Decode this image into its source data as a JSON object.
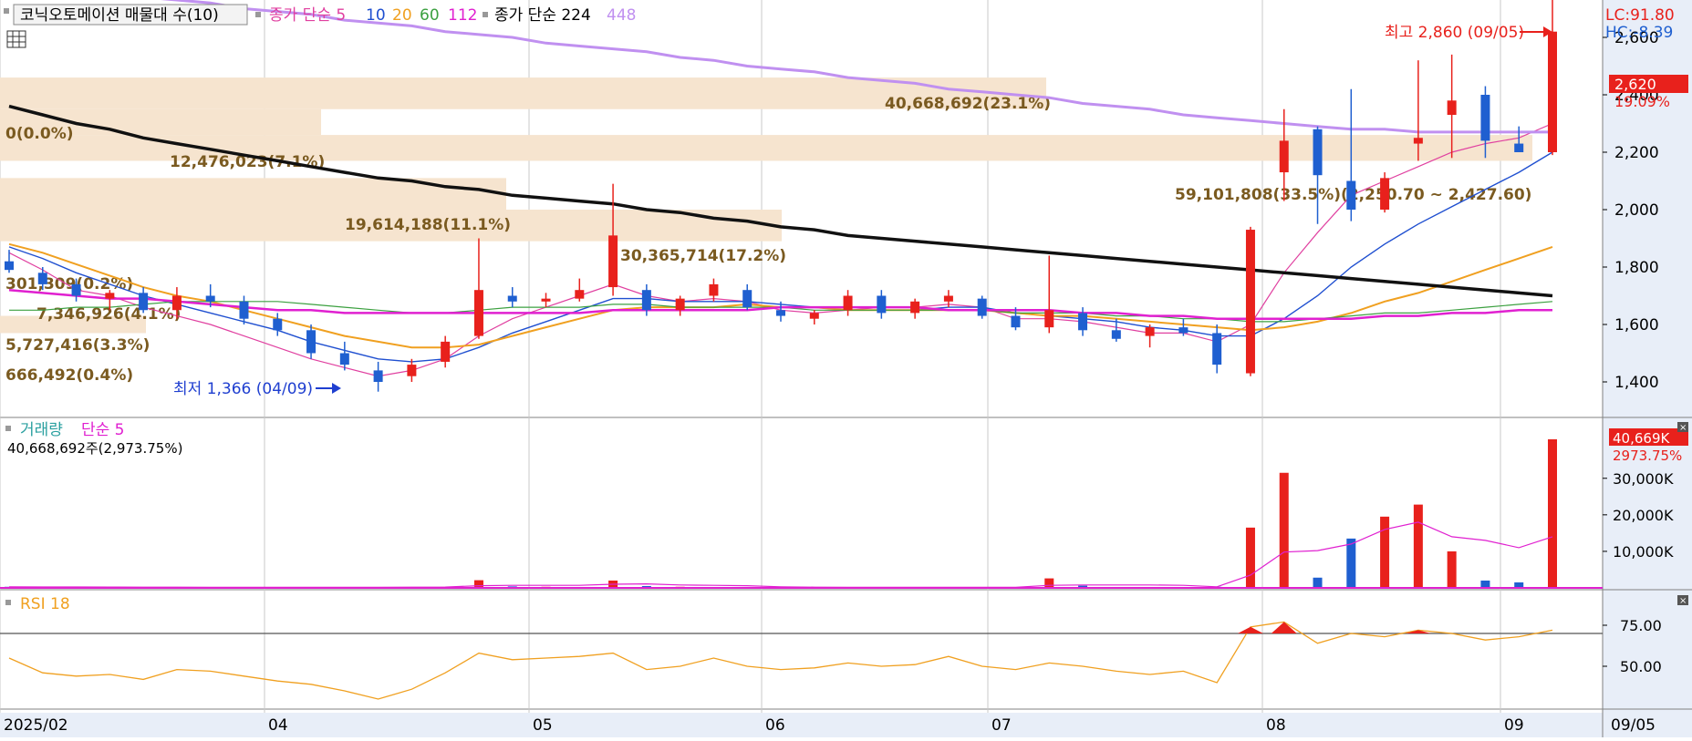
{
  "legend": {
    "stock_name": "코닉오토메이션 매물대 수(10)",
    "ma_label": "종가 단순 5",
    "ma_periods": [
      {
        "label": "10",
        "color": "#1f4fd0"
      },
      {
        "label": "20",
        "color": "#f0a020"
      },
      {
        "label": "60",
        "color": "#3ca040"
      },
      {
        "label": "112",
        "color": "#e020d0"
      }
    ],
    "ma5_color": "#e040a0",
    "long_label": "종가 단순 224",
    "long_period_extra": "448",
    "long_extra_color": "#c090f0"
  },
  "price_panel": {
    "lc": "LC:91.80",
    "hc": "HC:-8.39",
    "high_annotation": "최고 2,860 (09/05)",
    "low_annotation": "최저 1,366 (04/09)",
    "current_price": "2,620",
    "current_change": "19.09%",
    "y_ticks": [
      "2,600",
      "2,400",
      "2,200",
      "2,000",
      "1,800",
      "1,600",
      "1,400"
    ],
    "volume_profile": [
      {
        "label": "40,668,692(23.1%)",
        "low": 2350,
        "high": 2460
      },
      {
        "label": "0(0.0%)",
        "low": null,
        "high": null
      },
      {
        "label": "12,476,023(7.1%)",
        "low": 2260,
        "high": 2350
      },
      {
        "label": "59,101,808(33.5%)(2,250.70 ~ 2,427.60)",
        "low": 2170,
        "high": 2260
      },
      {
        "label": "19,614,188(11.1%)",
        "low": 2000,
        "high": 2110
      },
      {
        "label": "30,365,714(17.2%)",
        "low": 1890,
        "high": 2000
      },
      {
        "label": "301,309(0.2%)",
        "low": null,
        "high": null
      },
      {
        "label": "7,346,926(4.1%)",
        "low": null,
        "high": null
      },
      {
        "label": "5,727,416(3.3%)",
        "low": 1570,
        "high": 1630
      },
      {
        "label": "666,492(0.4%)",
        "low": null,
        "high": null
      }
    ]
  },
  "volume_panel": {
    "title": "거래량",
    "ma_label": "단순 5",
    "info": "40,668,692주(2,973.75%)",
    "current_value": "40,669K",
    "current_pct": "2973.75%",
    "y_ticks": [
      "30,000K",
      "20,000K",
      "10,000K"
    ]
  },
  "rsi_panel": {
    "title": "RSI 18",
    "y_ticks": [
      "75.00",
      "50.00"
    ]
  },
  "x_axis": {
    "labels": [
      "2025/02",
      "04",
      "05",
      "06",
      "07",
      "08",
      "09"
    ],
    "current_date": "09/05"
  },
  "colors": {
    "up": "#e8211c",
    "down": "#1f5fd0",
    "ma224": "#111111",
    "ma448": "#c090f0",
    "rsi": "#f0a020",
    "profile": "#f6e4cf",
    "profile_text": "#7a5a20"
  },
  "chart_data": {
    "type": "candlestick",
    "x_range": [
      "2025-02-03",
      "2025-09-05"
    ],
    "ylim": [
      1366,
      2860
    ],
    "candles": [
      {
        "date": "2025-02-03",
        "open": 1820,
        "high": 1860,
        "low": 1780,
        "close": 1790
      },
      {
        "date": "2025-02-10",
        "open": 1780,
        "high": 1800,
        "low": 1720,
        "close": 1740
      },
      {
        "date": "2025-02-17",
        "open": 1740,
        "high": 1760,
        "low": 1680,
        "close": 1700
      },
      {
        "date": "2025-02-24",
        "open": 1690,
        "high": 1720,
        "low": 1650,
        "close": 1710
      },
      {
        "date": "2025-03-03",
        "open": 1710,
        "high": 1730,
        "low": 1640,
        "close": 1650
      },
      {
        "date": "2025-03-10",
        "open": 1650,
        "high": 1730,
        "low": 1620,
        "close": 1700
      },
      {
        "date": "2025-03-17",
        "open": 1700,
        "high": 1740,
        "low": 1660,
        "close": 1680
      },
      {
        "date": "2025-03-24",
        "open": 1680,
        "high": 1700,
        "low": 1600,
        "close": 1620
      },
      {
        "date": "2025-03-31",
        "open": 1620,
        "high": 1640,
        "low": 1560,
        "close": 1580
      },
      {
        "date": "2025-04-04",
        "open": 1580,
        "high": 1600,
        "low": 1480,
        "close": 1500
      },
      {
        "date": "2025-04-07",
        "open": 1500,
        "high": 1540,
        "low": 1440,
        "close": 1460
      },
      {
        "date": "2025-04-09",
        "open": 1440,
        "high": 1470,
        "low": 1366,
        "close": 1400
      },
      {
        "date": "2025-04-14",
        "open": 1420,
        "high": 1480,
        "low": 1400,
        "close": 1460
      },
      {
        "date": "2025-04-21",
        "open": 1470,
        "high": 1560,
        "low": 1450,
        "close": 1540
      },
      {
        "date": "2025-04-25",
        "open": 1560,
        "high": 1900,
        "low": 1550,
        "close": 1720
      },
      {
        "date": "2025-04-30",
        "open": 1700,
        "high": 1730,
        "low": 1660,
        "close": 1680
      },
      {
        "date": "2025-05-07",
        "open": 1680,
        "high": 1710,
        "low": 1660,
        "close": 1690
      },
      {
        "date": "2025-05-14",
        "open": 1690,
        "high": 1760,
        "low": 1680,
        "close": 1720
      },
      {
        "date": "2025-05-21",
        "open": 1730,
        "high": 2090,
        "low": 1700,
        "close": 1910
      },
      {
        "date": "2025-05-23",
        "open": 1720,
        "high": 1740,
        "low": 1630,
        "close": 1650
      },
      {
        "date": "2025-05-28",
        "open": 1650,
        "high": 1700,
        "low": 1630,
        "close": 1690
      },
      {
        "date": "2025-06-04",
        "open": 1700,
        "high": 1760,
        "low": 1680,
        "close": 1740
      },
      {
        "date": "2025-06-11",
        "open": 1720,
        "high": 1740,
        "low": 1650,
        "close": 1660
      },
      {
        "date": "2025-06-18",
        "open": 1650,
        "high": 1680,
        "low": 1610,
        "close": 1630
      },
      {
        "date": "2025-06-25",
        "open": 1620,
        "high": 1650,
        "low": 1600,
        "close": 1640
      },
      {
        "date": "2025-07-02",
        "open": 1650,
        "high": 1720,
        "low": 1630,
        "close": 1700
      },
      {
        "date": "2025-07-09",
        "open": 1700,
        "high": 1720,
        "low": 1620,
        "close": 1640
      },
      {
        "date": "2025-07-16",
        "open": 1640,
        "high": 1690,
        "low": 1620,
        "close": 1680
      },
      {
        "date": "2025-07-23",
        "open": 1680,
        "high": 1720,
        "low": 1660,
        "close": 1700
      },
      {
        "date": "2025-07-30",
        "open": 1690,
        "high": 1700,
        "low": 1620,
        "close": 1630
      },
      {
        "date": "2025-08-06",
        "open": 1630,
        "high": 1660,
        "low": 1580,
        "close": 1590
      },
      {
        "date": "2025-08-13",
        "open": 1590,
        "high": 1840,
        "low": 1570,
        "close": 1650
      },
      {
        "date": "2025-08-20",
        "open": 1640,
        "high": 1660,
        "low": 1560,
        "close": 1580
      },
      {
        "date": "2025-08-27",
        "open": 1580,
        "high": 1620,
        "low": 1540,
        "close": 1550
      },
      {
        "date": "2025-09-03",
        "open": 1560,
        "high": 1600,
        "low": 1520,
        "close": 1590
      },
      {
        "date": "2025-09-10",
        "open": 1590,
        "high": 1620,
        "low": 1560,
        "close": 1570
      },
      {
        "date": "2025-09-17",
        "open": 1570,
        "high": 1600,
        "low": 1430,
        "close": 1460
      },
      {
        "date": "2025-09-22",
        "open": 1430,
        "high": 1940,
        "low": 1420,
        "close": 1930
      },
      {
        "date": "2025-09-23",
        "open": 2130,
        "high": 2350,
        "low": 2030,
        "close": 2240
      },
      {
        "date": "2025-09-24",
        "open": 2280,
        "high": 2290,
        "low": 1950,
        "close": 2120
      },
      {
        "date": "2025-09-25",
        "open": 2100,
        "high": 2420,
        "low": 1960,
        "close": 2000
      },
      {
        "date": "2025-09-26",
        "open": 2000,
        "high": 2130,
        "low": 1990,
        "close": 2110
      },
      {
        "date": "2025-09-29",
        "open": 2230,
        "high": 2520,
        "low": 2170,
        "close": 2250
      },
      {
        "date": "2025-09-30",
        "open": 2330,
        "high": 2540,
        "low": 2180,
        "close": 2380
      },
      {
        "date": "2025-10-01",
        "open": 2400,
        "high": 2430,
        "low": 2180,
        "close": 2240
      },
      {
        "date": "2025-10-02",
        "open": 2230,
        "high": 2290,
        "low": 2200,
        "close": 2200
      },
      {
        "date": "2025-10-03",
        "open": 2200,
        "high": 2860,
        "low": 2190,
        "close": 2620
      }
    ],
    "moving_averages": [
      {
        "name": "5",
        "values": [
          1850,
          1790,
          1720,
          1700,
          1660,
          1630,
          1600,
          1560,
          1520,
          1480,
          1450,
          1420,
          1440,
          1480,
          1560,
          1620,
          1660,
          1700,
          1740,
          1700,
          1680,
          1690,
          1680,
          1650,
          1640,
          1650,
          1660,
          1660,
          1670,
          1660,
          1620,
          1620,
          1610,
          1590,
          1570,
          1570,
          1540,
          1600,
          1780,
          1920,
          2050,
          2100,
          2150,
          2200,
          2230,
          2250,
          2300
        ]
      },
      {
        "name": "10",
        "values": [
          1870,
          1830,
          1780,
          1740,
          1700,
          1670,
          1640,
          1610,
          1580,
          1540,
          1510,
          1480,
          1470,
          1480,
          1520,
          1570,
          1610,
          1650,
          1690,
          1690,
          1680,
          1680,
          1680,
          1670,
          1660,
          1650,
          1650,
          1650,
          1660,
          1660,
          1640,
          1630,
          1620,
          1610,
          1590,
          1580,
          1560,
          1560,
          1620,
          1700,
          1800,
          1880,
          1950,
          2010,
          2070,
          2130,
          2200
        ]
      },
      {
        "name": "20",
        "values": [
          1880,
          1850,
          1810,
          1770,
          1730,
          1700,
          1680,
          1650,
          1620,
          1590,
          1560,
          1540,
          1520,
          1520,
          1530,
          1560,
          1590,
          1620,
          1650,
          1660,
          1660,
          1660,
          1670,
          1660,
          1660,
          1650,
          1650,
          1650,
          1650,
          1650,
          1640,
          1630,
          1630,
          1620,
          1610,
          1600,
          1590,
          1580,
          1590,
          1610,
          1640,
          1680,
          1710,
          1750,
          1790,
          1830,
          1870
        ]
      },
      {
        "name": "60",
        "values": [
          1650,
          1650,
          1660,
          1660,
          1670,
          1680,
          1680,
          1680,
          1680,
          1670,
          1660,
          1650,
          1640,
          1640,
          1650,
          1660,
          1660,
          1660,
          1670,
          1670,
          1660,
          1660,
          1660,
          1660,
          1650,
          1650,
          1650,
          1650,
          1650,
          1650,
          1640,
          1640,
          1640,
          1630,
          1630,
          1620,
          1620,
          1610,
          1610,
          1620,
          1630,
          1640,
          1640,
          1650,
          1660,
          1670,
          1680
        ]
      },
      {
        "name": "112",
        "values": [
          1720,
          1710,
          1700,
          1690,
          1690,
          1680,
          1670,
          1660,
          1650,
          1650,
          1640,
          1640,
          1640,
          1640,
          1640,
          1640,
          1640,
          1640,
          1650,
          1650,
          1650,
          1650,
          1650,
          1660,
          1660,
          1660,
          1660,
          1660,
          1650,
          1650,
          1650,
          1650,
          1640,
          1640,
          1630,
          1630,
          1620,
          1620,
          1620,
          1620,
          1620,
          1630,
          1630,
          1640,
          1640,
          1650,
          1650
        ]
      },
      {
        "name": "224",
        "values": [
          2360,
          2330,
          2300,
          2280,
          2250,
          2230,
          2210,
          2190,
          2170,
          2150,
          2130,
          2110,
          2100,
          2080,
          2070,
          2050,
          2040,
          2030,
          2020,
          2000,
          1990,
          1970,
          1960,
          1940,
          1930,
          1910,
          1900,
          1890,
          1880,
          1870,
          1860,
          1850,
          1840,
          1830,
          1820,
          1810,
          1800,
          1790,
          1780,
          1770,
          1760,
          1750,
          1740,
          1730,
          1720,
          1710,
          1700
        ]
      },
      {
        "name": "448",
        "values": [
          2800,
          2780,
          2770,
          2760,
          2740,
          2730,
          2720,
          2700,
          2690,
          2680,
          2660,
          2650,
          2640,
          2620,
          2610,
          2600,
          2580,
          2570,
          2560,
          2550,
          2530,
          2520,
          2500,
          2490,
          2480,
          2460,
          2450,
          2440,
          2420,
          2410,
          2400,
          2390,
          2370,
          2360,
          2350,
          2330,
          2320,
          2310,
          2300,
          2290,
          2280,
          2280,
          2270,
          2270,
          2270,
          2270,
          2270
        ]
      }
    ],
    "volume_k": [
      300,
      200,
      180,
      150,
      170,
      160,
      140,
      150,
      130,
      160,
      180,
      200,
      220,
      260,
      2100,
      400,
      300,
      250,
      2000,
      500,
      300,
      200,
      180,
      150,
      140,
      160,
      170,
      150,
      140,
      150,
      160,
      2600,
      600,
      250,
      180,
      200,
      300,
      16500,
      31500,
      2800,
      13500,
      19500,
      22800,
      10000,
      2000,
      1500,
      40669
    ],
    "volume_ma5_k": [
      300,
      260,
      240,
      220,
      200,
      190,
      180,
      170,
      160,
      160,
      170,
      180,
      200,
      230,
      600,
      700,
      700,
      700,
      1000,
      1100,
      800,
      700,
      600,
      300,
      200,
      170,
      170,
      160,
      160,
      160,
      160,
      700,
      800,
      800,
      800,
      700,
      300,
      3500,
      9800,
      10200,
      12000,
      16000,
      18000,
      14000,
      13000,
      11000,
      14000
    ],
    "rsi": [
      55,
      46,
      44,
      45,
      42,
      48,
      47,
      44,
      41,
      39,
      35,
      30,
      36,
      46,
      58,
      54,
      55,
      56,
      58,
      48,
      50,
      55,
      50,
      48,
      49,
      52,
      50,
      51,
      56,
      50,
      48,
      52,
      50,
      47,
      45,
      47,
      40,
      74,
      77,
      64,
      70,
      68,
      72,
      70,
      66,
      68,
      72
    ],
    "rsi_signal": 70
  }
}
